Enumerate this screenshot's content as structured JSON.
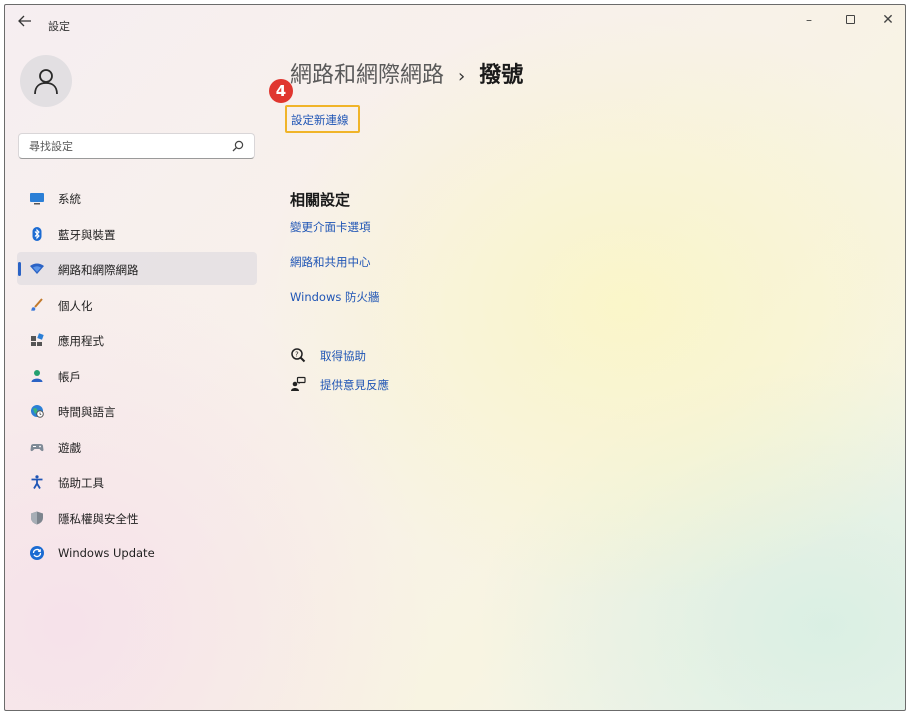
{
  "window": {
    "title": "設定",
    "controls": {
      "minimize": "–",
      "close": "✕"
    }
  },
  "search": {
    "placeholder": "尋找設定"
  },
  "sidebar": {
    "items": [
      {
        "label": "系統",
        "icon": "monitor-icon"
      },
      {
        "label": "藍牙與裝置",
        "icon": "bluetooth-icon"
      },
      {
        "label": "網路和網際網路",
        "icon": "wifi-icon",
        "selected": true
      },
      {
        "label": "個人化",
        "icon": "brush-icon"
      },
      {
        "label": "應用程式",
        "icon": "apps-icon"
      },
      {
        "label": "帳戶",
        "icon": "person-icon"
      },
      {
        "label": "時間與語言",
        "icon": "globe-clock-icon"
      },
      {
        "label": "遊戲",
        "icon": "gamepad-icon"
      },
      {
        "label": "協助工具",
        "icon": "accessibility-icon"
      },
      {
        "label": "隱私權與安全性",
        "icon": "shield-icon"
      },
      {
        "label": "Windows Update",
        "icon": "update-icon"
      }
    ]
  },
  "header": {
    "parent": "網路和網際網路",
    "separator": "›",
    "current": "撥號"
  },
  "annotation": {
    "step": "4"
  },
  "main": {
    "setup_link": "設定新連線",
    "related": {
      "title": "相關設定",
      "links": [
        "變更介面卡選項",
        "網路和共用中心",
        "Windows 防火牆"
      ]
    },
    "help": {
      "get_help": "取得協助",
      "feedback": "提供意見反應"
    }
  },
  "colors": {
    "accent": "#2b63c5",
    "link": "#1f55b5",
    "callout": "#e0362f",
    "highlight": "#f0b429"
  }
}
